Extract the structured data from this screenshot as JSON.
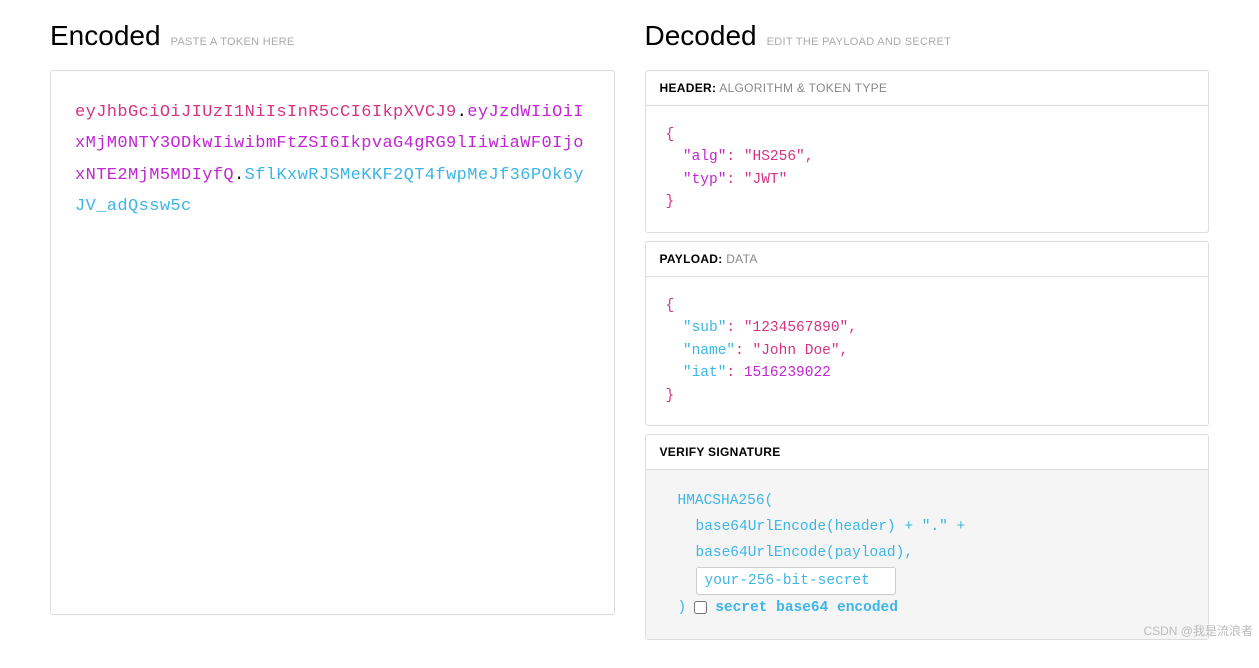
{
  "encoded": {
    "title": "Encoded",
    "subtitle": "PASTE A TOKEN HERE",
    "token": {
      "header": "eyJhbGciOiJIUzI1NiIsInR5cCI6IkpXVCJ9",
      "payload": "eyJzdWIiOiIxMjM0NTY3ODkwIiwibmFtZSI6IkpvaG4gRG9lIiwiaWF0IjoxNTE2MjM5MDIyfQ",
      "signature": "SflKxwRJSMeKKF2QT4fwpMeJf36POk6yJV_adQssw5c"
    }
  },
  "decoded": {
    "title": "Decoded",
    "subtitle": "EDIT THE PAYLOAD AND SECRET",
    "header_section": {
      "label": "HEADER:",
      "sublabel": "ALGORITHM & TOKEN TYPE",
      "alg_key": "\"alg\"",
      "alg_val": "\"HS256\"",
      "typ_key": "\"typ\"",
      "typ_val": "\"JWT\""
    },
    "payload_section": {
      "label": "PAYLOAD:",
      "sublabel": "DATA",
      "sub_key": "\"sub\"",
      "sub_val": "\"1234567890\"",
      "name_key": "\"name\"",
      "name_val": "\"John Doe\"",
      "iat_key": "\"iat\"",
      "iat_val": "1516239022"
    },
    "signature_section": {
      "label": "VERIFY SIGNATURE",
      "line1": "HMACSHA256(",
      "line2": "base64UrlEncode(header) + \".\" +",
      "line3": "base64UrlEncode(payload),",
      "secret_value": "your-256-bit-secret",
      "close_paren": ")",
      "checkbox_label": "secret base64 encoded"
    }
  },
  "watermark": "CSDN @我是流浪者"
}
